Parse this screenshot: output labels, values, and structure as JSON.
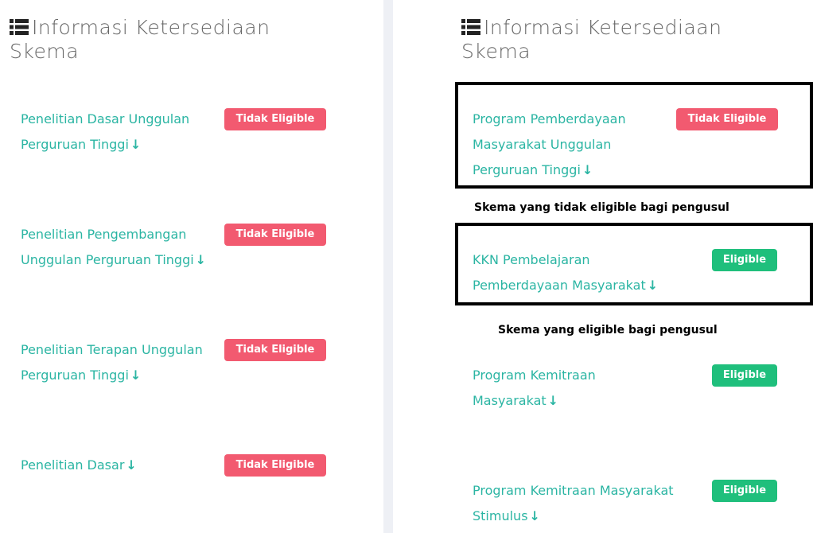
{
  "left_panel": {
    "title_line1": "Informasi Ketersediaan",
    "title_line2": "Skema",
    "items": [
      {
        "line1": "Penelitian Dasar Unggulan",
        "line2": "Perguruan Tinggi",
        "badge": "Tidak Eligible"
      },
      {
        "line1": "Penelitian Pengembangan",
        "line2": "Unggulan Perguruan Tinggi",
        "badge": "Tidak Eligible"
      },
      {
        "line1": "Penelitian Terapan Unggulan",
        "line2": "Perguruan Tinggi",
        "badge": "Tidak Eligible"
      },
      {
        "line1": "Penelitian Dasar",
        "line2": "",
        "badge": "Tidak Eligible"
      }
    ]
  },
  "right_panel": {
    "title_line1": "Informasi Ketersediaan",
    "title_line2": "Skema",
    "items": [
      {
        "line1": "Program Pemberdayaan",
        "line2": "Masyarakat Unggulan",
        "line3": "Perguruan Tinggi",
        "badge": "Tidak Eligible"
      },
      {
        "line1": "KKN Pembelajaran",
        "line2": "Pemberdayaan Masyarakat",
        "badge": "Eligible"
      },
      {
        "line1": "Program Kemitraan",
        "line2": "Masyarakat",
        "badge": "Eligible"
      },
      {
        "line1": "Program Kemitraan Masyarakat",
        "line2": "Stimulus",
        "badge": "Eligible"
      }
    ],
    "annotations": {
      "not_eligible": "Skema yang tidak eligible bagi pengusul",
      "eligible": "Skema yang eligible bagi pengusul"
    }
  },
  "icons": {
    "title": "list-icon",
    "scheme_link": "arrow-down-icon"
  },
  "colors": {
    "link": "#2bb5a3",
    "not_eligible": "#f25a70",
    "eligible": "#1fbf7c",
    "title": "#666666"
  }
}
